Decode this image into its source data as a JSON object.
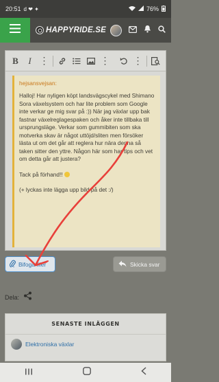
{
  "status_bar": {
    "time": "20:51",
    "notification_glyphs": "d ❤ ✦",
    "battery": "76%"
  },
  "header": {
    "logo_text": "HAPPYRIDE.SE"
  },
  "editor": {
    "quote_author": "hejsansvejsan:",
    "quote_paragraphs": [
      "Halloj! Har nyligen köpt landsvägscykel med Shimano Sora växelsystem och har lite problem som Google inte verkar ge mig svar på :)) När jag växlar upp bak fastnar växelreglagespaken och åker inte tillbaka till ursprungsläge. Verkar som gummibiten som ska motverka skav är något uttöjd/sliten men försöker lästa ut om det går att reglera hur nära denna så taken sitter den yttre. Någon här som har tips och vet om detta går att justera?",
      "Tack på förhand!!",
      "(+ lyckas inte lägga upp bild på det :/)"
    ]
  },
  "actions": {
    "attach_label": "Bifoga filer",
    "reply_label": "Skicka svar"
  },
  "share": {
    "label": "Dela:"
  },
  "latest": {
    "title": "SENASTE INLÄGGEN",
    "items": [
      {
        "title": "Elektroniska växlar"
      }
    ]
  },
  "colors": {
    "header_accent": "#3aa34a",
    "quote_accent": "#e3b23a",
    "link": "#2e6fa8",
    "annotation_arrow": "#e8403a"
  }
}
